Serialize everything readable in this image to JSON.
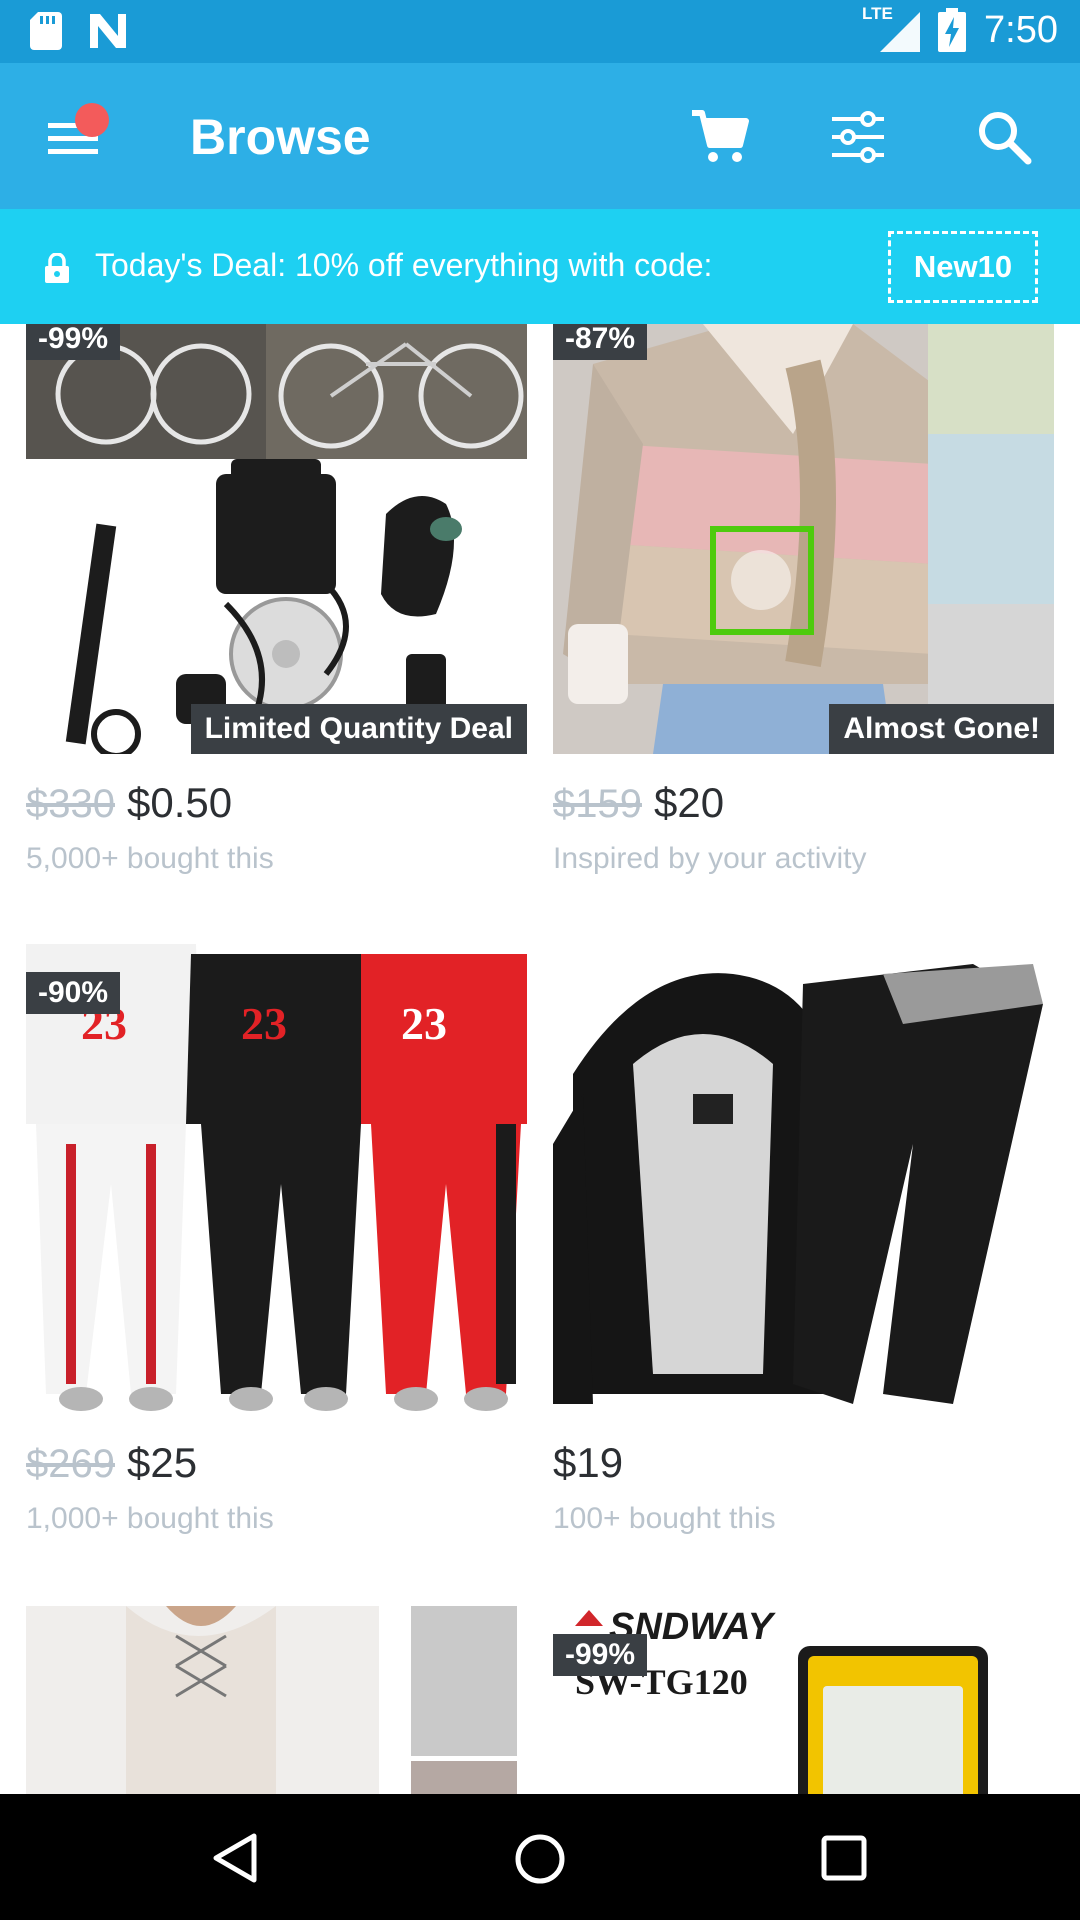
{
  "status_bar": {
    "time": "7:50",
    "network": "LTE"
  },
  "app_bar": {
    "title": "Browse"
  },
  "deal_banner": {
    "text": "Today's Deal: 10% off everything with code:",
    "code": "New10"
  },
  "products": [
    {
      "discount": "-99%",
      "tag": "Limited Quantity Deal",
      "old_price": "$330",
      "price": "$0.50",
      "subtext": "5,000+ bought this"
    },
    {
      "discount": "-87%",
      "tag": "Almost Gone!",
      "old_price": "$159",
      "price": "$20",
      "subtext": "Inspired by your activity"
    },
    {
      "discount": "-90%",
      "old_price": "$269",
      "price": "$25",
      "subtext": "1,000+ bought this"
    },
    {
      "price": "$19",
      "subtext": "100+ bought this"
    },
    {},
    {
      "discount": "-99%",
      "brand": "SNDWAY",
      "model": "SW-TG120"
    }
  ],
  "colors": {
    "status_bar": "#1a9bd6",
    "app_bar": "#2dafe6",
    "banner": "#1ed0f2",
    "badge": "#3a3f44",
    "notification": "#f35b5b"
  }
}
